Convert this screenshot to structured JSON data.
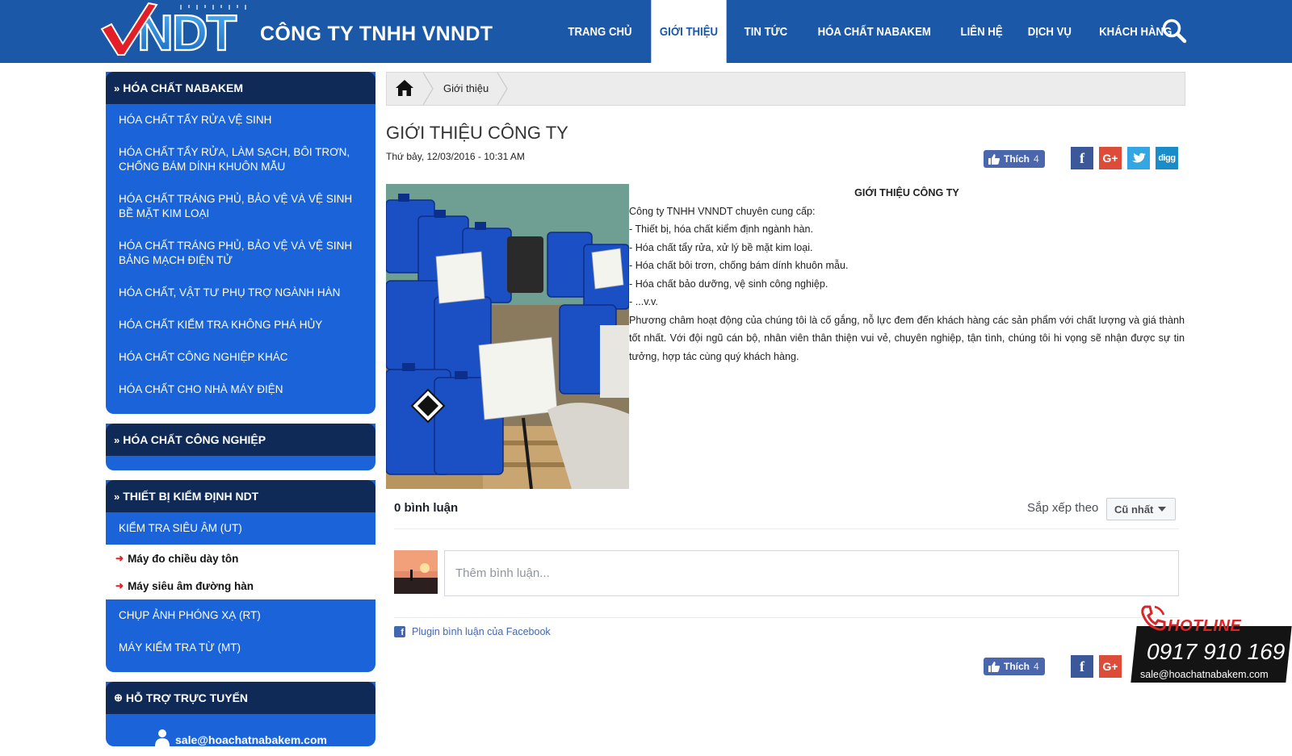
{
  "header": {
    "logo_text": "VNDT",
    "company_name": "CÔNG TY TNHH VNNDT",
    "nav": [
      {
        "label": "TRANG CHỦ",
        "active": false
      },
      {
        "label": "GIỚI THIỆU",
        "active": true
      },
      {
        "label": "TIN TỨC",
        "active": false
      },
      {
        "label": "HÓA CHẤT NABAKEM",
        "active": false
      },
      {
        "label": "LIÊN HỆ",
        "active": false
      },
      {
        "label": "DỊCH VỤ",
        "active": false
      },
      {
        "label": "KHÁCH HÀNG",
        "active": false
      }
    ],
    "search_icon": "search-icon",
    "brand_color": "#1b58a8"
  },
  "sidebar": {
    "nabakem": {
      "title": "HÓA CHẤT NABAKEM",
      "items": [
        "HÓA CHẤT TẨY RỬA VỆ SINH",
        "HÓA CHẤT TẨY RỬA, LÀM SẠCH, BÔI TRƠN, CHỐNG BÁM DÍNH KHUÔN MẪU",
        "HÓA CHẤT TRÁNG PHỦ, BẢO VỆ VÀ VỆ SINH BỀ MẶT KIM LOẠI",
        "HÓA CHẤT TRÁNG PHỦ, BẢO VỆ VÀ VỆ SINH BẢNG MẠCH ĐIỆN TỬ",
        "HÓA CHẤT, VẬT TƯ PHỤ TRỢ NGÀNH HÀN",
        "HÓA CHẤT KIỂM TRA KHÔNG PHÁ HỦY",
        "HÓA CHẤT CÔNG NGHIỆP KHÁC",
        "HÓA CHẤT CHO NHÀ MÁY ĐIỆN"
      ]
    },
    "industrial": {
      "title": "HÓA CHẤT CÔNG NGHIỆP"
    },
    "ndt": {
      "title": "THIẾT BỊ KIỂM ĐỊNH NDT",
      "items": [
        "KIỂM TRA SIÊU ÂM (UT)",
        "Máy đo chiều dày tôn",
        "Máy siêu âm đường hàn",
        "CHỤP ẢNH PHÓNG XẠ (RT)",
        "MÁY KIỂM TRA TỪ (MT)"
      ]
    },
    "support": {
      "title": "HỖ TRỢ TRỰC TUYẾN",
      "email": "sale@hoachatnabakem.com"
    }
  },
  "breadcrumb": {
    "home_icon": "home-icon",
    "current": "Giới thiệu"
  },
  "article": {
    "title": "GIỚI THIỆU CÔNG TY",
    "date": "Thứ bảy, 12/03/2016 - 10:31 AM",
    "heading": "GIỚI THIỆU CÔNG TY",
    "intro": "Công ty TNHH VNNDT chuyên cung cấp:",
    "bullets": [
      "- Thiết bị, hóa chất kiểm định ngành hàn.",
      "- Hóa chất tẩy rửa, xử lý bề mặt kim loại.",
      "- Hóa chất bôi trơn, chống bám dính khuôn mẫu.",
      "- Hóa chất bảo dưỡng, vệ sinh công nghiệp.",
      "- ...v.v."
    ],
    "paragraph": " Phương châm hoạt động của chúng tôi là cố gắng, nỗ lực đem đến khách hàng các sản phẩm   với chất lượng và giá thành tốt nhất. Với đội ngũ cán bộ, nhân viên thân thiện vui vẻ, chuyên nghiệp,  tận tình, chúng tôi hi vọng sẽ nhận được sự tin tưởng, hợp tác cùng quý khách hàng.",
    "image": "chemical-containers-photo"
  },
  "share": {
    "like_label": "Thích",
    "like_count": "4",
    "buttons": [
      "facebook-icon",
      "google-plus-icon",
      "twitter-icon",
      "digg-icon"
    ],
    "gplus_text": "G+",
    "digg_text": "digg"
  },
  "comments": {
    "count_label": "0 bình luận",
    "sort_label": "Sắp xếp theo",
    "sort_value": "Cũ nhất",
    "placeholder": "Thêm bình luận...",
    "plugin_label": "Plugin bình luận của Facebook"
  },
  "hotline": {
    "label": "HOTLINE",
    "number": "0917 910 169",
    "email": "sale@hoachatnabakem.com"
  }
}
